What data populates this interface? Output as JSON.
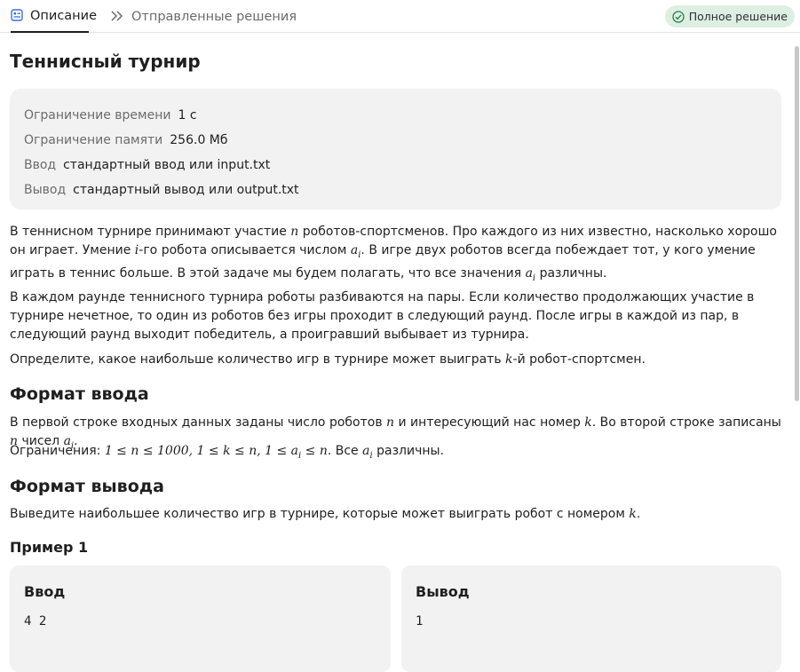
{
  "tabs": {
    "description": "Описание",
    "submissions": "Отправленные решения"
  },
  "status_badge": "Полное решение",
  "problem": {
    "title": "Теннисный турнир",
    "limits": [
      {
        "key": "Ограничение времени",
        "value": "1 с"
      },
      {
        "key": "Ограничение памяти",
        "value": "256.0 Мб"
      },
      {
        "key": "Ввод",
        "value": "стандартный ввод или input.txt"
      },
      {
        "key": "Вывод",
        "value": "стандартный вывод или output.txt"
      }
    ],
    "statement": {
      "p1_a": "В теннисном турнире принимают участие ",
      "p1_n": "n",
      "p1_b": " роботов-спортсменов. Про каждого из них известно, насколько хорошо он играет. Умение ",
      "p1_i": "i",
      "p1_c": "-го робота описывается числом ",
      "p1_ai": "a",
      "p1_ai_sub": "i",
      "p1_d": ". В игре двух роботов всегда побеждает тот, у кого умение играть в теннис больше. В этой задаче мы будем полагать, что все значения ",
      "p1_ai2": "a",
      "p1_ai2_sub": "i",
      "p1_e": " различны.",
      "p2": "В каждом раунде теннисного турнира роботы разбиваются на пары. Если количество продолжающих участие в турнире нечетное, то один из роботов без игры проходит в следующий раунд. После игры в каждой из пар, в следующий раунд выходит победитель, а проигравший выбывает из турнира.",
      "p3_a": "Определите, какое наибольше количество игр в турнире может выиграть ",
      "p3_k": "k",
      "p3_b": "-й робот-спортсмен."
    },
    "input_format": {
      "heading": "Формат ввода",
      "l1_a": "В первой строке входных данных заданы число роботов ",
      "l1_n": "n",
      "l1_b": " и интересующий нас номер ",
      "l1_k": "k",
      "l1_c": ". Во второй строке записаны ",
      "l1_n2": "n",
      "l1_d": " чисел ",
      "l1_ai": "a",
      "l1_ai_sub": "i",
      "l1_e": ".",
      "l2_a": "Ограничения: ",
      "l2_math": "1 ≤ n ≤ 1000, 1 ≤ k ≤ n, 1 ≤ a",
      "l2_math_sub": "i",
      "l2_math_end": " ≤ n",
      "l2_b": ". Все ",
      "l2_ai": "a",
      "l2_ai_sub": "i",
      "l2_c": " различны."
    },
    "output_format": {
      "heading": "Формат вывода",
      "l1_a": "Выведите наибольшее количество игр в турнире, которые может выиграть робот с номером ",
      "l1_k": "k",
      "l1_b": "."
    },
    "example": {
      "heading": "Пример 1",
      "input_title": "Ввод",
      "input_data": "4 2",
      "output_title": "Вывод",
      "output_data": "1"
    }
  },
  "colors": {
    "badge_bg": "#dcefe2",
    "badge_icon": "#2e7d4f",
    "card_bg": "#f2f2f2",
    "tab_icon": "#3b6fd8"
  }
}
